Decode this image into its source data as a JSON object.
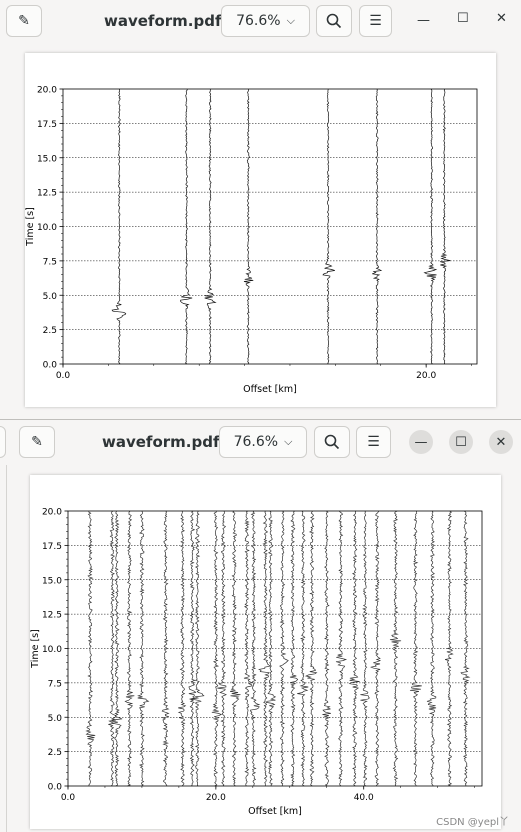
{
  "top": {
    "title": "waveform.pdf",
    "zoom": "76.6%",
    "chart": {
      "xlabel": "Offset [km]",
      "ylabel": "Time [s]",
      "yticks": [
        "0.0",
        "2.5",
        "5.0",
        "7.5",
        "10.0",
        "12.5",
        "15.0",
        "17.5",
        "20.0"
      ],
      "xticks": [
        "0.0",
        "20.0"
      ]
    }
  },
  "bottom": {
    "title": "waveform.pdf",
    "zoom": "76.6%",
    "chart": {
      "xlabel": "Offset [km]",
      "ylabel": "Time [s]",
      "yticks": [
        "0.0",
        "2.5",
        "5.0",
        "7.5",
        "10.0",
        "12.5",
        "15.0",
        "17.5",
        "20.0"
      ],
      "xticks": [
        "0.0",
        "20.0",
        "40.0"
      ]
    }
  },
  "watermark": "CSDN @yepl丫",
  "icons": {
    "edit": "pencil-icon",
    "search": "search-icon",
    "menu": "hamburger-icon",
    "chevron": "chevron-down-icon"
  },
  "chart_data": [
    {
      "type": "line",
      "xlabel": "Offset [km]",
      "ylabel": "Time [s]",
      "xlim": [
        0,
        22.8
      ],
      "ylim": [
        0,
        20
      ],
      "grid": "horizontal",
      "x": [
        3.1,
        6.8,
        8.1,
        10.2,
        14.6,
        17.3,
        20.3,
        21.0
      ],
      "events": [
        3.8,
        4.8,
        4.7,
        6.3,
        6.8,
        6.5,
        6.6,
        7.5
      ]
    },
    {
      "type": "line",
      "xlabel": "Offset [km]",
      "ylabel": "Time [s]",
      "xlim": [
        0,
        56
      ],
      "ylim": [
        0,
        20
      ],
      "grid": "horizontal",
      "x": [
        3,
        6,
        6.6,
        8.3,
        10,
        13.2,
        15.5,
        16.8,
        17.5,
        20,
        21,
        22.5,
        24.2,
        25.1,
        26.7,
        27.4,
        29,
        30.4,
        31.8,
        33,
        35,
        36.9,
        38.8,
        40.2,
        41.8,
        44.3,
        47,
        49.3,
        51.6,
        53.8
      ],
      "events": [
        3.8,
        4.8,
        4.7,
        6.3,
        6.2,
        5.2,
        5.5,
        7.1,
        6.4,
        5.1,
        7.2,
        6.6,
        7.5,
        5.8,
        8.4,
        6.2,
        9.1,
        7.8,
        6.9,
        8.2,
        5.4,
        9.0,
        7.6,
        6.5,
        8.8,
        10.5,
        7.2,
        6.0,
        9.4,
        8.1
      ]
    }
  ]
}
